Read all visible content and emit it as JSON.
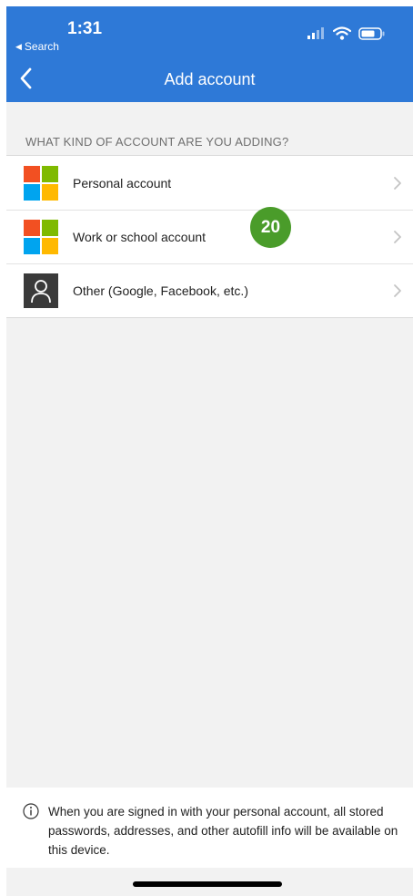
{
  "status_bar": {
    "time": "1:31",
    "back_app": "Search",
    "back_glyph": "◀"
  },
  "nav": {
    "title": "Add account",
    "back_icon": "chevron-left-icon"
  },
  "section_label": "WHAT KIND OF ACCOUNT ARE YOU ADDING?",
  "accounts": [
    {
      "label": "Personal account",
      "icon": "microsoft-logo-icon"
    },
    {
      "label": "Work or school account",
      "icon": "microsoft-logo-icon"
    },
    {
      "label": "Other (Google, Facebook, etc.)",
      "icon": "person-icon"
    }
  ],
  "step_badge": "20",
  "info": {
    "icon": "info-icon",
    "text": "When you are signed in with your personal account, all stored passwords, addresses, and other autofill info will be available on this device."
  },
  "colors": {
    "header": "#2e79d7",
    "ms_red": "#f25022",
    "ms_green": "#7fba00",
    "ms_blue": "#00a4ef",
    "ms_yellow": "#ffb900",
    "badge": "#4a9c2a"
  }
}
